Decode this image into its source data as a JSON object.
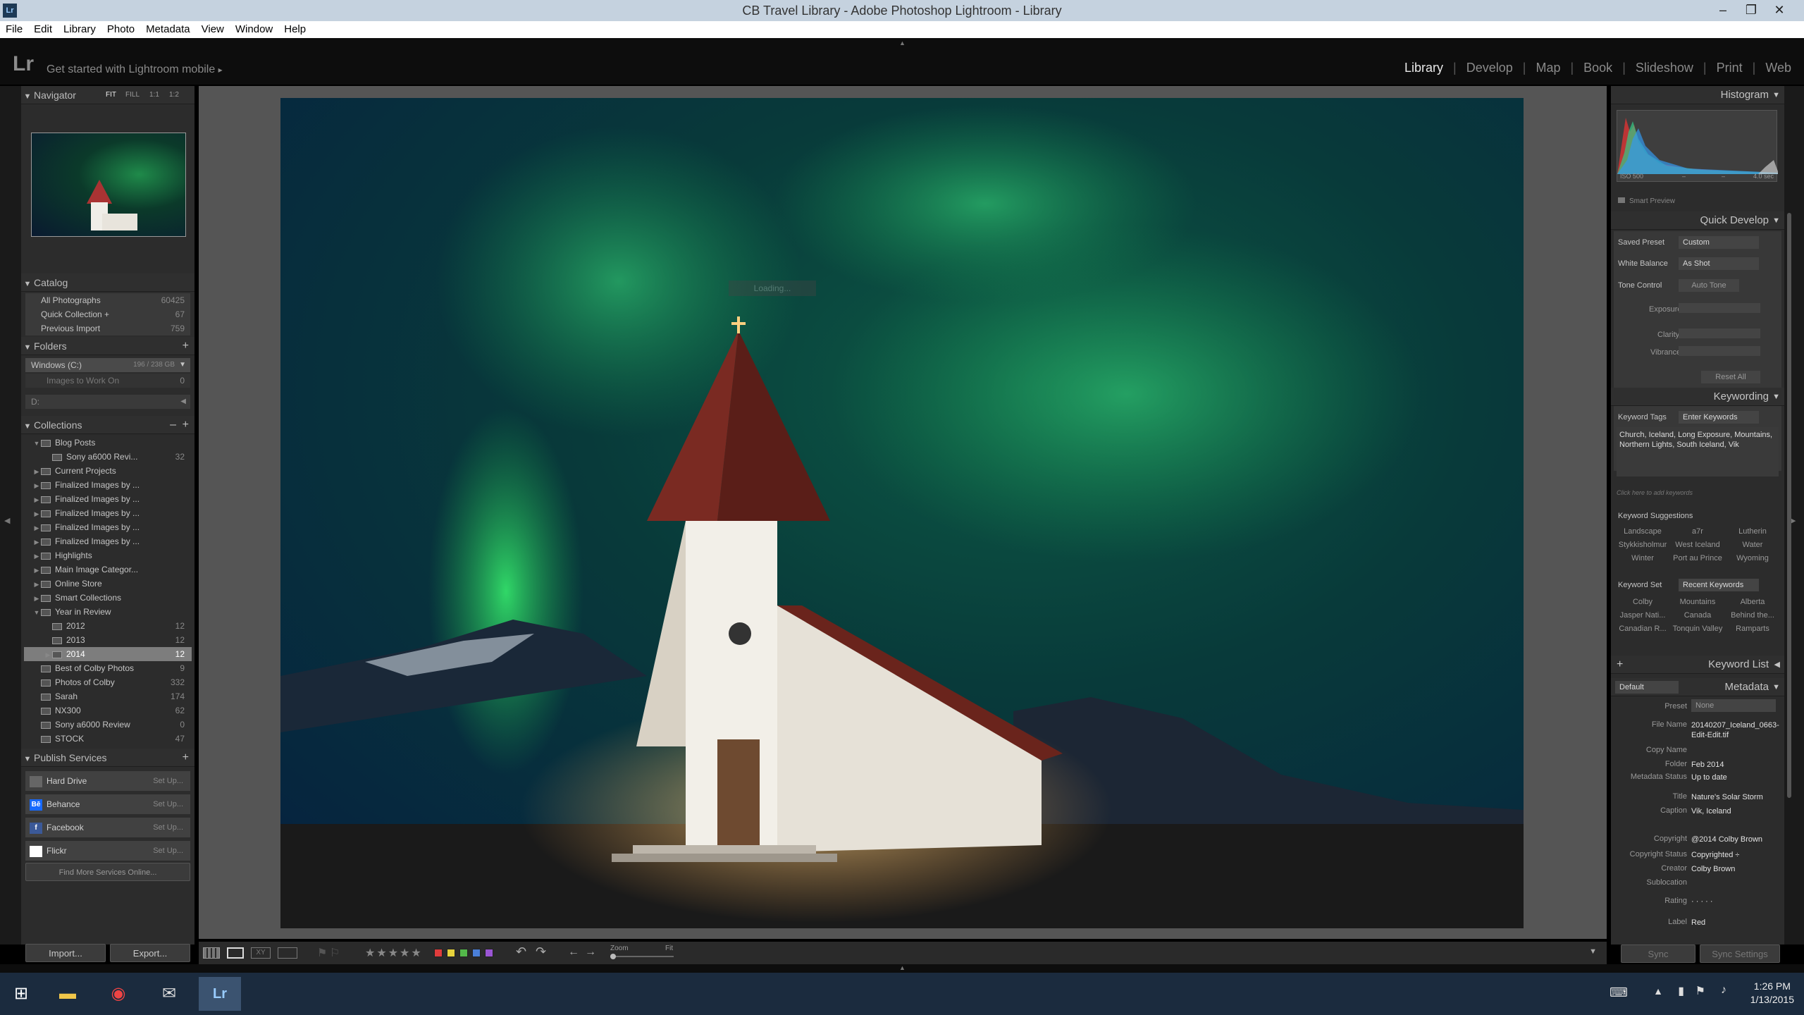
{
  "titlebar": {
    "title": "CB Travel Library - Adobe Photoshop Lightroom - Library",
    "app_icon": "Lr"
  },
  "menubar": {
    "items": [
      "File",
      "Edit",
      "Library",
      "Photo",
      "Metadata",
      "View",
      "Window",
      "Help"
    ]
  },
  "identity": {
    "logo": "Lr",
    "mobile_text": "Get started with Lightroom mobile",
    "mobile_arrow": "▸"
  },
  "modules": {
    "items": [
      "Library",
      "Develop",
      "Map",
      "Book",
      "Slideshow",
      "Print",
      "Web"
    ],
    "active": "Library"
  },
  "navigator": {
    "title": "Navigator",
    "fit": "FIT",
    "fill": "FILL",
    "one": "1:1",
    "ratio": "1:2"
  },
  "catalog": {
    "title": "Catalog",
    "items": [
      {
        "label": "All Photographs",
        "count": "60425"
      },
      {
        "label": "Quick Collection +",
        "count": "67"
      },
      {
        "label": "Previous Import",
        "count": "759"
      }
    ]
  },
  "folders": {
    "title": "Folders",
    "add": "+",
    "items": [
      {
        "label": "Windows (C:)",
        "count": "196 / 238 GB"
      },
      {
        "label": "Images to Work On",
        "count": "0"
      },
      {
        "label": "D:",
        "count": ""
      }
    ]
  },
  "collections": {
    "title": "Collections",
    "minus": "–",
    "add": "+",
    "items": [
      {
        "label": "Blog Posts",
        "count": "",
        "indent": 1,
        "tg": "▼"
      },
      {
        "label": "Sony a6000 Revi...",
        "count": "32",
        "indent": 2,
        "tg": ""
      },
      {
        "label": "Current Projects",
        "count": "",
        "indent": 1,
        "tg": "▶"
      },
      {
        "label": "Finalized Images by ...",
        "count": "",
        "indent": 1,
        "tg": "▶"
      },
      {
        "label": "Finalized Images by ...",
        "count": "",
        "indent": 1,
        "tg": "▶"
      },
      {
        "label": "Finalized Images by ...",
        "count": "",
        "indent": 1,
        "tg": "▶"
      },
      {
        "label": "Finalized Images by ...",
        "count": "",
        "indent": 1,
        "tg": "▶"
      },
      {
        "label": "Finalized Images by ...",
        "count": "",
        "indent": 1,
        "tg": "▶"
      },
      {
        "label": "Highlights",
        "count": "",
        "indent": 1,
        "tg": "▶"
      },
      {
        "label": "Main Image Categor...",
        "count": "",
        "indent": 1,
        "tg": "▶"
      },
      {
        "label": "Online Store",
        "count": "",
        "indent": 1,
        "tg": "▶"
      },
      {
        "label": "Smart Collections",
        "count": "",
        "indent": 1,
        "tg": "▶"
      },
      {
        "label": "Year in Review",
        "count": "",
        "indent": 1,
        "tg": "▼"
      },
      {
        "label": "2012",
        "count": "12",
        "indent": 2,
        "tg": ""
      },
      {
        "label": "2013",
        "count": "12",
        "indent": 2,
        "tg": ""
      },
      {
        "label": "2014",
        "count": "12",
        "indent": 2,
        "tg": "▶",
        "selected": true
      },
      {
        "label": "Best of Colby Photos",
        "count": "9",
        "indent": 1,
        "tg": ""
      },
      {
        "label": "Photos of Colby",
        "count": "332",
        "indent": 1,
        "tg": ""
      },
      {
        "label": "Sarah",
        "count": "174",
        "indent": 1,
        "tg": ""
      },
      {
        "label": "NX300",
        "count": "62",
        "indent": 1,
        "tg": ""
      },
      {
        "label": "Sony a6000 Review",
        "count": "0",
        "indent": 1,
        "tg": ""
      },
      {
        "label": "STOCK",
        "count": "47",
        "indent": 1,
        "tg": ""
      }
    ]
  },
  "publish": {
    "title": "Publish Services",
    "add": "+",
    "items": [
      {
        "label": "Hard Drive",
        "setup": "Set Up...",
        "icon": "hard-drive-icon",
        "color": "#666666",
        "glyph": ""
      },
      {
        "label": "Behance",
        "setup": "Set Up...",
        "icon": "behance-icon",
        "color": "#1769ff",
        "glyph": "Bē"
      },
      {
        "label": "Facebook",
        "setup": "Set Up...",
        "icon": "facebook-icon",
        "color": "#3b5998",
        "glyph": "f"
      },
      {
        "label": "Flickr",
        "setup": "Set Up...",
        "icon": "flickr-icon",
        "color": "#ffffff",
        "glyph": ""
      }
    ],
    "find_more": "Find More Services Online..."
  },
  "left_buttons": {
    "import": "Import...",
    "export": "Export..."
  },
  "overlay": {
    "text": "Loading..."
  },
  "histogram": {
    "title": "Histogram",
    "iso": "ISO 500",
    "dash1": "–",
    "dash2": "–",
    "shutter": "4.0 sec",
    "smart_preview": "Smart Preview"
  },
  "quick_develop": {
    "title": "Quick Develop",
    "saved_preset_label": "Saved Preset",
    "saved_preset_value": "Custom",
    "white_balance_label": "White Balance",
    "white_balance_value": "As Shot",
    "tone_control_label": "Tone Control",
    "auto_tone": "Auto Tone",
    "exposure_label": "Exposure",
    "clarity_label": "Clarity",
    "vibrance_label": "Vibrance",
    "reset_all": "Reset All"
  },
  "keywording": {
    "title": "Keywording",
    "tags_label": "Keyword Tags",
    "tags_mode": "Enter Keywords",
    "keywords_text": "Church, Iceland, Long Exposure, Mountains, Northern Lights, South Iceland, Vik",
    "add_hint": "Click here to add keywords",
    "suggestions_title": "Keyword Suggestions",
    "suggestions": [
      "Landscape",
      "a7r",
      "Lutherin",
      "Stykkisholmur",
      "West Iceland",
      "Water",
      "Winter",
      "Port au Prince",
      "Wyoming"
    ],
    "set_label": "Keyword Set",
    "set_value": "Recent Keywords",
    "set_items": [
      "Colby",
      "Mountains",
      "Alberta",
      "Jasper Nati...",
      "Canada",
      "Behind the...",
      "Canadian R...",
      "Tonquin Valley",
      "Ramparts"
    ]
  },
  "keyword_list": {
    "title": "Keyword List",
    "add": "+"
  },
  "metadata": {
    "title": "Metadata",
    "preset_default": "Default",
    "preset_label": "Preset",
    "preset_value": "None",
    "fields": [
      {
        "label": "File Name",
        "value": "20140207_Iceland_0663-Edit-Edit.tif"
      },
      {
        "label": "Copy Name",
        "value": ""
      },
      {
        "label": "Folder",
        "value": "Feb 2014"
      },
      {
        "label": "Metadata Status",
        "value": "Up to date"
      },
      {
        "label": "Title",
        "value": "Nature's Solar Storm"
      },
      {
        "label": "Caption",
        "value": "Vik, Iceland"
      },
      {
        "label": "Copyright",
        "value": "@2014 Colby Brown"
      },
      {
        "label": "Copyright Status",
        "value": "Copyrighted ÷"
      },
      {
        "label": "Creator",
        "value": "Colby Brown"
      },
      {
        "label": "Sublocation",
        "value": ""
      },
      {
        "label": "Rating",
        "value": "·  ·  ·  ·  ·"
      },
      {
        "label": "Label",
        "value": "Red"
      }
    ]
  },
  "sync": {
    "sync": "Sync",
    "settings": "Sync Settings"
  },
  "toolbar": {
    "stars": "★★★★★",
    "zoom_label": "Zoom",
    "fit_label": "Fit",
    "labels": [
      "#e03c3c",
      "#e6d23c",
      "#53b84a",
      "#4a7fd8",
      "#9a55d4"
    ]
  },
  "taskbar": {
    "time": "1:26 PM",
    "date": "1/13/2015"
  },
  "colors": {
    "accent": "#4a7fd8",
    "panel": "#2c2c2c",
    "selected": "#7d7d7d"
  }
}
